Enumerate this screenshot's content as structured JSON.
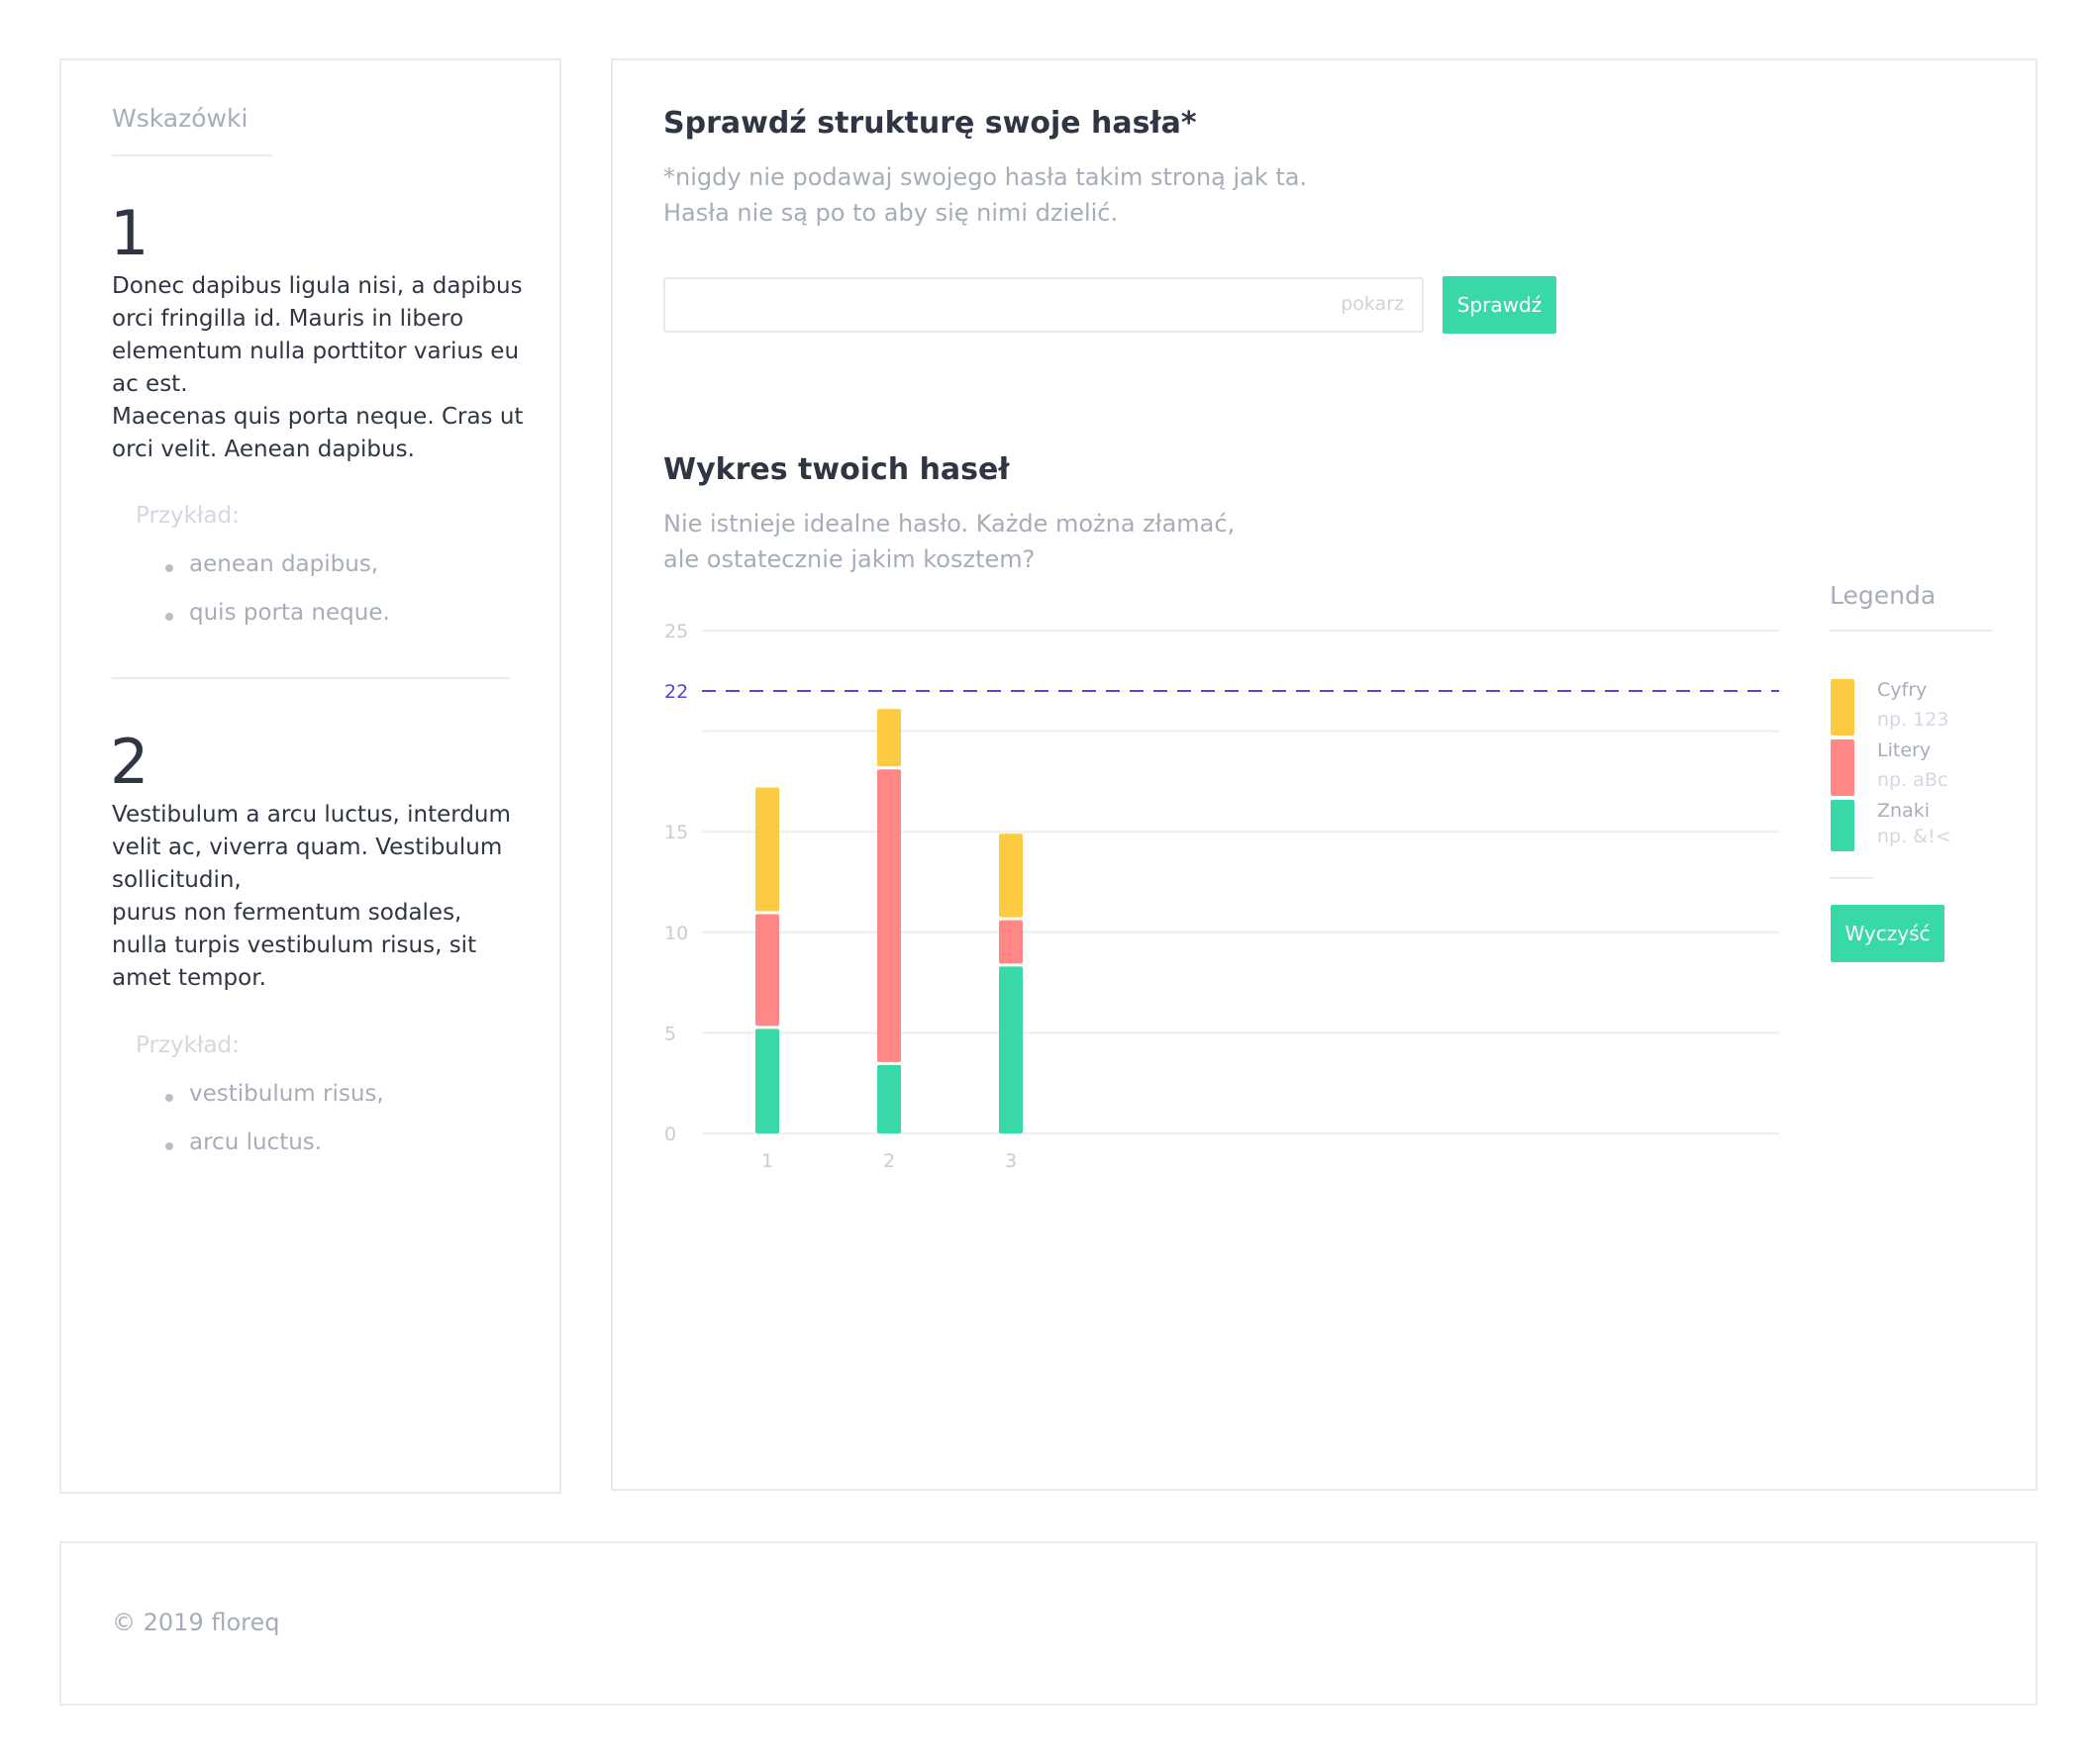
{
  "sidebar": {
    "title": "Wskazówki",
    "tips": [
      {
        "number": "1",
        "lines": [
          "Donec dapibus ligula nisi, a dapibus",
          "orci fringilla id. Mauris in libero",
          "elementum nulla porttitor varius eu",
          "ac est.",
          "Maecenas quis porta neque. Cras ut",
          "orci velit. Aenean dapibus."
        ],
        "example_label": "Przykład:",
        "examples": [
          "aenean dapibus,",
          "quis porta neque."
        ]
      },
      {
        "number": "2",
        "lines": [
          "Vestibulum a arcu luctus, interdum",
          "velit ac, viverra quam. Vestibulum",
          "sollicitudin,",
          "purus non fermentum sodales,",
          "nulla turpis vestibulum risus, sit",
          "amet tempor."
        ],
        "example_label": "Przykład:",
        "examples": [
          "vestibulum risus,",
          "arcu luctus."
        ]
      }
    ]
  },
  "check": {
    "title": "Sprawdź strukturę swoje hasła*",
    "subtitle_lines": [
      "*nigdy nie podawaj swojego hasła takim stroną jak ta.",
      "Hasła nie są po to aby się nimi dzielić."
    ],
    "input_value": "",
    "show_label": "pokarz",
    "button_label": "Sprawdź"
  },
  "graph": {
    "title": "Wykres twoich haseł",
    "subtitle_lines": [
      "Nie istnieje idealne hasło. Każde można złamać,",
      "ale ostatecznie jakim kosztem?"
    ],
    "clear_label": "Wyczyść"
  },
  "legend": {
    "title": "Legenda",
    "items": [
      {
        "name": "Cyfry",
        "example": "np. 123",
        "color": "#fccb42"
      },
      {
        "name": "Litery",
        "example": "np. aBc",
        "color": "#ff8886"
      },
      {
        "name": "Znaki",
        "example": "np. &!<",
        "color": "#39d8a8"
      }
    ]
  },
  "chart_data": {
    "type": "bar",
    "stacked": true,
    "categories": [
      "1",
      "2",
      "3"
    ],
    "series": [
      {
        "name": "Znaki",
        "color": "#39d8a8",
        "values": [
          5.2,
          3.4,
          8.3
        ]
      },
      {
        "name": "Litery",
        "color": "#ff8886",
        "values": [
          5.7,
          14.7,
          2.3
        ]
      },
      {
        "name": "Cyfry",
        "color": "#fccb42",
        "values": [
          6.3,
          3.0,
          4.3
        ]
      }
    ],
    "yticks": [
      "0",
      "5",
      "10",
      "15",
      "22",
      "25"
    ],
    "ylim": [
      0,
      25
    ],
    "reference_line": {
      "value": 22,
      "label": "22",
      "color": "#5b3fd6"
    },
    "grid": true
  },
  "footer": {
    "copyright": "© 2019 floreq"
  }
}
